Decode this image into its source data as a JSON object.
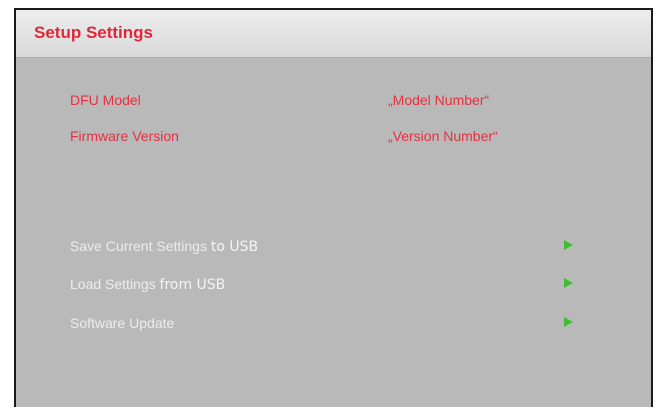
{
  "window": {
    "title": "Setup Settings"
  },
  "info": [
    {
      "label": "DFU Model",
      "value": "„Model Number“"
    },
    {
      "label": "Firmware Version",
      "value": "„Version Number“"
    }
  ],
  "menu": [
    {
      "label": "Save Current Settings",
      "suffix": "to USB",
      "icon": "play-arrow-icon"
    },
    {
      "label": "Load Settings",
      "suffix": "from USB",
      "icon": "play-arrow-icon"
    },
    {
      "label": "Software Update",
      "suffix": "",
      "icon": "play-arrow-icon"
    }
  ],
  "colors": {
    "title": "#e0273a",
    "info_text": "#e8303f",
    "menu_text": "#ececec",
    "arrow": "#3fbf2f",
    "panel_bg": "#b9b9b9"
  }
}
